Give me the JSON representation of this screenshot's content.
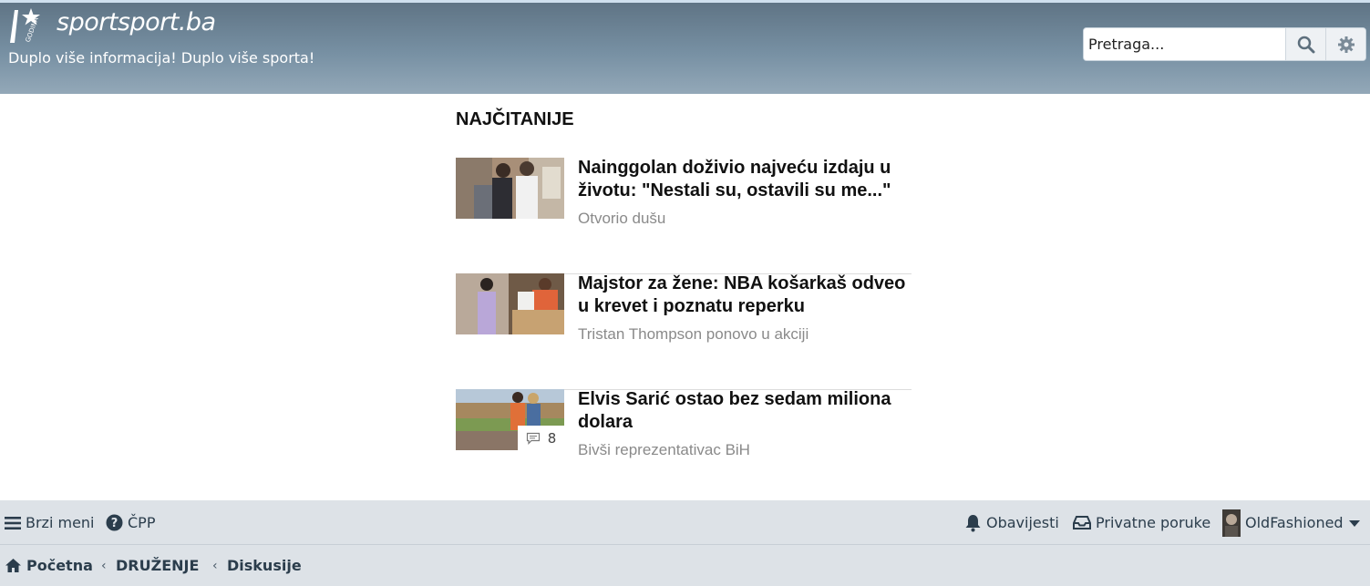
{
  "header": {
    "logo_text": "sportsport.ba",
    "tagline": "Duplo više informacija! Duplo više sporta!",
    "logo_icon": "star-logo-icon"
  },
  "search": {
    "placeholder": "Pretraga...",
    "search_icon": "search-icon",
    "settings_icon": "gear-icon"
  },
  "section": {
    "title": "NAJČITANIJE"
  },
  "articles": [
    {
      "title": "Nainggolan doživio najveću izdaju u životu: \"Nestali su, ostavili su me...\"",
      "subtitle": "Otvorio dušu"
    },
    {
      "title": "Majstor za žene: NBA košarkaš odveo u krevet i poznatu reperku",
      "subtitle": "Tristan Thompson ponovo u akciji"
    },
    {
      "title": "Elvis Sarić ostao bez sedam miliona dolara",
      "subtitle": "Bivši reprezentativac BiH",
      "comments": "8"
    }
  ],
  "nav": {
    "quick_menu": "Brzi meni",
    "faq": "ČPP",
    "notifications": "Obavijesti",
    "messages": "Privatne poruke",
    "username": "OldFashioned"
  },
  "breadcrumb": {
    "home": "Početna",
    "level1": "DRUŽENJE",
    "level2": "Diskusije"
  },
  "colors": {
    "header_top": "#5f7485",
    "header_bottom": "#93a8b8",
    "nav_bg": "#dde2e7",
    "nav_text": "#2b3d4c"
  }
}
